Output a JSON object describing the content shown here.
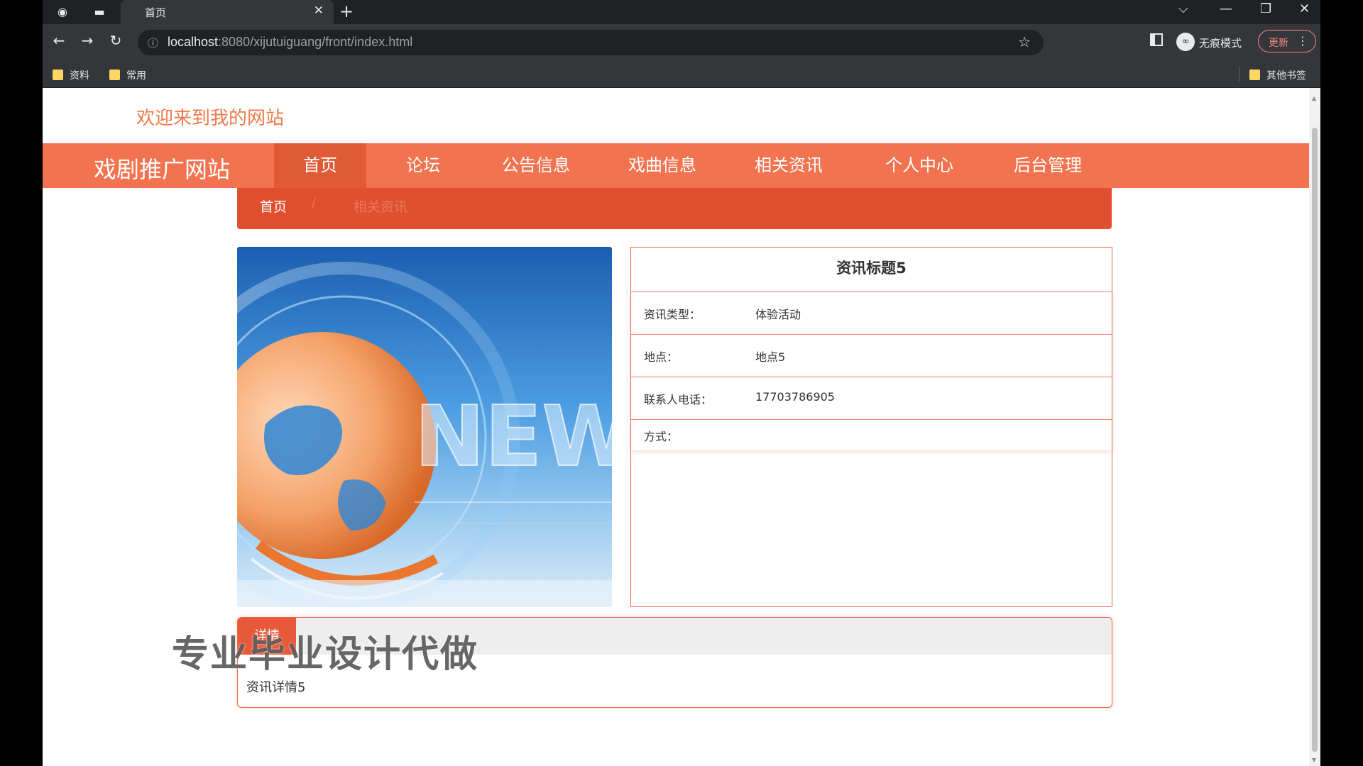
{
  "browser": {
    "tab_title": "首页",
    "tab_close": "✕",
    "new_tab": "+",
    "window_controls": {
      "list": "⌵",
      "minimize": "—",
      "restore": "❐",
      "close": "✕"
    },
    "nav": {
      "back": "←",
      "forward": "→",
      "reload": "↻",
      "info": "ⓘ"
    },
    "url_host": "localhost",
    "url_rest": ":8080/xijutuiguang/front/index.html",
    "bookmark_star": "☆",
    "incognito_label": "无痕模式",
    "update_label": "更新",
    "menu_dots": "⋮",
    "bookmarks": [
      "资料",
      "常用"
    ],
    "other_bookmarks": "其他书签"
  },
  "site": {
    "welcome": "欢迎来到我的网站",
    "brand": "戏剧推广网站",
    "nav": [
      {
        "label": "首页",
        "active": true
      },
      {
        "label": "论坛",
        "active": false
      },
      {
        "label": "公告信息",
        "active": false
      },
      {
        "label": "戏曲信息",
        "active": false
      },
      {
        "label": "相关资讯",
        "active": false
      },
      {
        "label": "个人中心",
        "active": false
      },
      {
        "label": "后台管理",
        "active": false
      }
    ]
  },
  "breadcrumb": {
    "home": "首页",
    "separator": "/",
    "current": "相关资讯"
  },
  "hero": {
    "word": "NEW"
  },
  "info": {
    "title": "资讯标题5",
    "rows": [
      {
        "label": "资讯类型：",
        "value": "体验活动"
      },
      {
        "label": "地点：",
        "value": "地点5"
      },
      {
        "label": "联系人电话：",
        "value": "17703786905"
      },
      {
        "label": "方式：",
        "value": ""
      }
    ]
  },
  "detail": {
    "tab_label": "详情",
    "body": "资讯详情5"
  },
  "watermark": "专业毕业设计代做",
  "colors": {
    "brand_orange": "#f27350",
    "active_nav": "#e15a36",
    "crumb_bar": "#e04f2e",
    "welcome": "#f07a4a"
  }
}
